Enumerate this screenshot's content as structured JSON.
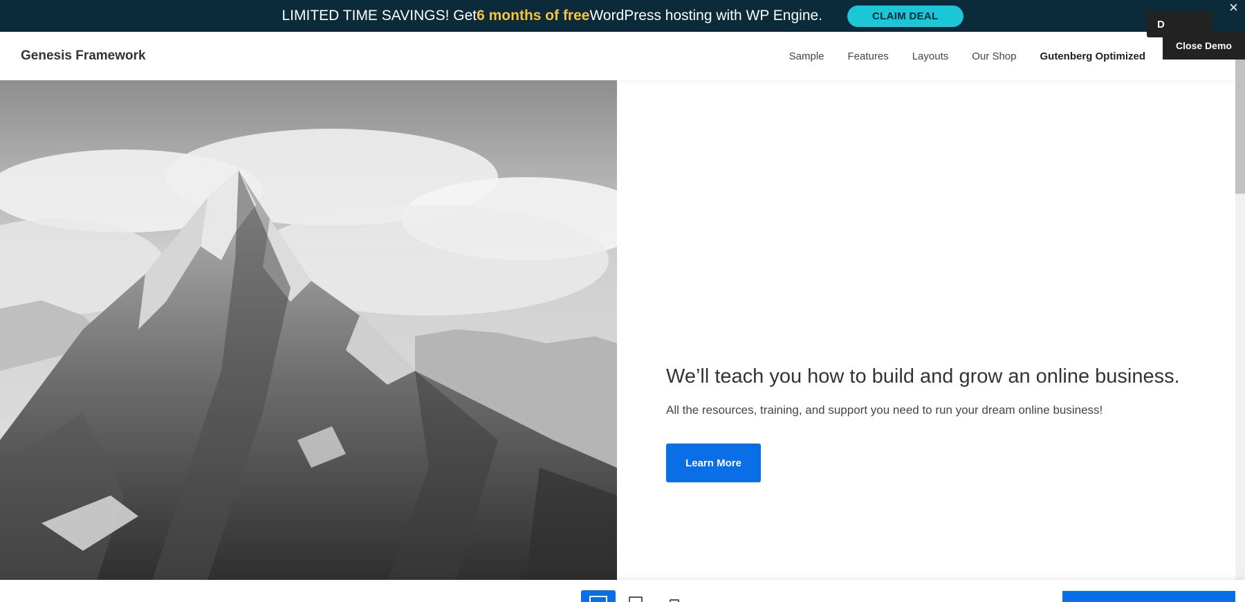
{
  "promo": {
    "text_before": "LIMITED TIME SAVINGS! Get ",
    "highlight": "6 months of free",
    "text_after": " WordPress hosting with WP Engine.",
    "cta": "CLAIM DEAL",
    "close": "×"
  },
  "header": {
    "brand": "Genesis Framework",
    "nav": [
      "Sample",
      "Features",
      "Layouts",
      "Our Shop",
      "Gutenberg Optimized"
    ],
    "download_partial": "D",
    "close_demo": "Close Demo"
  },
  "hero": {
    "title": "We’ll teach you how to build and grow an online business.",
    "subtitle": "All the resources, training, and support you need to run your dream online business!",
    "button": "Learn More"
  },
  "colors": {
    "promo_bg": "#0b2a3a",
    "highlight": "#f6c343",
    "claim_bg": "#1bc6d6",
    "primary": "#0a6ee6",
    "dark": "#222222"
  }
}
